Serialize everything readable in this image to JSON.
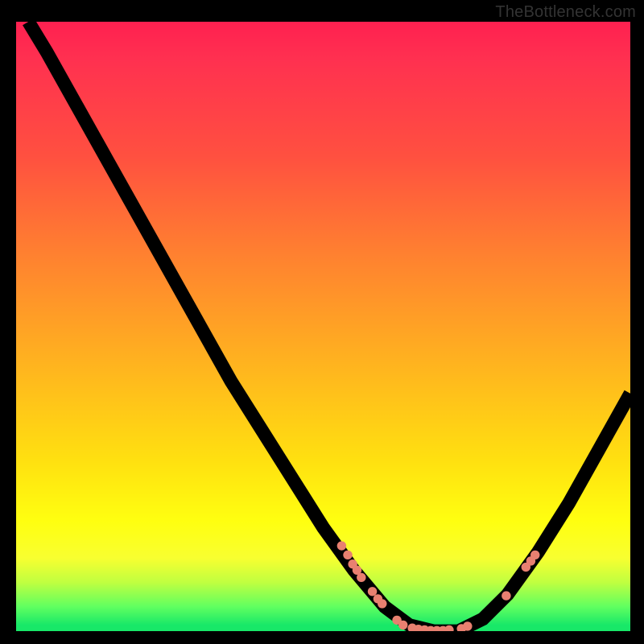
{
  "watermark": "TheBottleneck.com",
  "colors": {
    "background": "#000000",
    "curve": "#000000",
    "points": "#e88070"
  },
  "chart_data": {
    "type": "line",
    "title": "",
    "xlabel": "",
    "ylabel": "",
    "xlim": [
      0,
      100
    ],
    "ylim": [
      0,
      100
    ],
    "grid": false,
    "curve": [
      {
        "x": 2,
        "y": 100
      },
      {
        "x": 5,
        "y": 95
      },
      {
        "x": 10,
        "y": 86
      },
      {
        "x": 15,
        "y": 77
      },
      {
        "x": 20,
        "y": 68
      },
      {
        "x": 25,
        "y": 59
      },
      {
        "x": 30,
        "y": 50
      },
      {
        "x": 35,
        "y": 41
      },
      {
        "x": 40,
        "y": 33
      },
      {
        "x": 45,
        "y": 25
      },
      {
        "x": 50,
        "y": 17
      },
      {
        "x": 55,
        "y": 10
      },
      {
        "x": 60,
        "y": 4
      },
      {
        "x": 64,
        "y": 1
      },
      {
        "x": 68,
        "y": 0
      },
      {
        "x": 72,
        "y": 0
      },
      {
        "x": 76,
        "y": 2
      },
      {
        "x": 80,
        "y": 6
      },
      {
        "x": 85,
        "y": 13
      },
      {
        "x": 90,
        "y": 21
      },
      {
        "x": 95,
        "y": 30
      },
      {
        "x": 100,
        "y": 39
      }
    ],
    "highlighted_points": [
      {
        "x": 53.0,
        "y": 14.0
      },
      {
        "x": 54.0,
        "y": 12.5
      },
      {
        "x": 54.8,
        "y": 11.0
      },
      {
        "x": 55.5,
        "y": 10.0
      },
      {
        "x": 56.2,
        "y": 8.8
      },
      {
        "x": 58.0,
        "y": 6.5
      },
      {
        "x": 58.9,
        "y": 5.3
      },
      {
        "x": 59.6,
        "y": 4.5
      },
      {
        "x": 62.0,
        "y": 1.8
      },
      {
        "x": 63.0,
        "y": 1.0
      },
      {
        "x": 64.5,
        "y": 0.5
      },
      {
        "x": 65.5,
        "y": 0.3
      },
      {
        "x": 66.5,
        "y": 0.2
      },
      {
        "x": 67.5,
        "y": 0.1
      },
      {
        "x": 68.5,
        "y": 0.1
      },
      {
        "x": 69.5,
        "y": 0.1
      },
      {
        "x": 70.5,
        "y": 0.2
      },
      {
        "x": 72.5,
        "y": 0.4
      },
      {
        "x": 73.5,
        "y": 0.8
      },
      {
        "x": 79.8,
        "y": 5.8
      },
      {
        "x": 83.0,
        "y": 10.5
      },
      {
        "x": 83.8,
        "y": 11.5
      },
      {
        "x": 84.5,
        "y": 12.5
      }
    ]
  }
}
